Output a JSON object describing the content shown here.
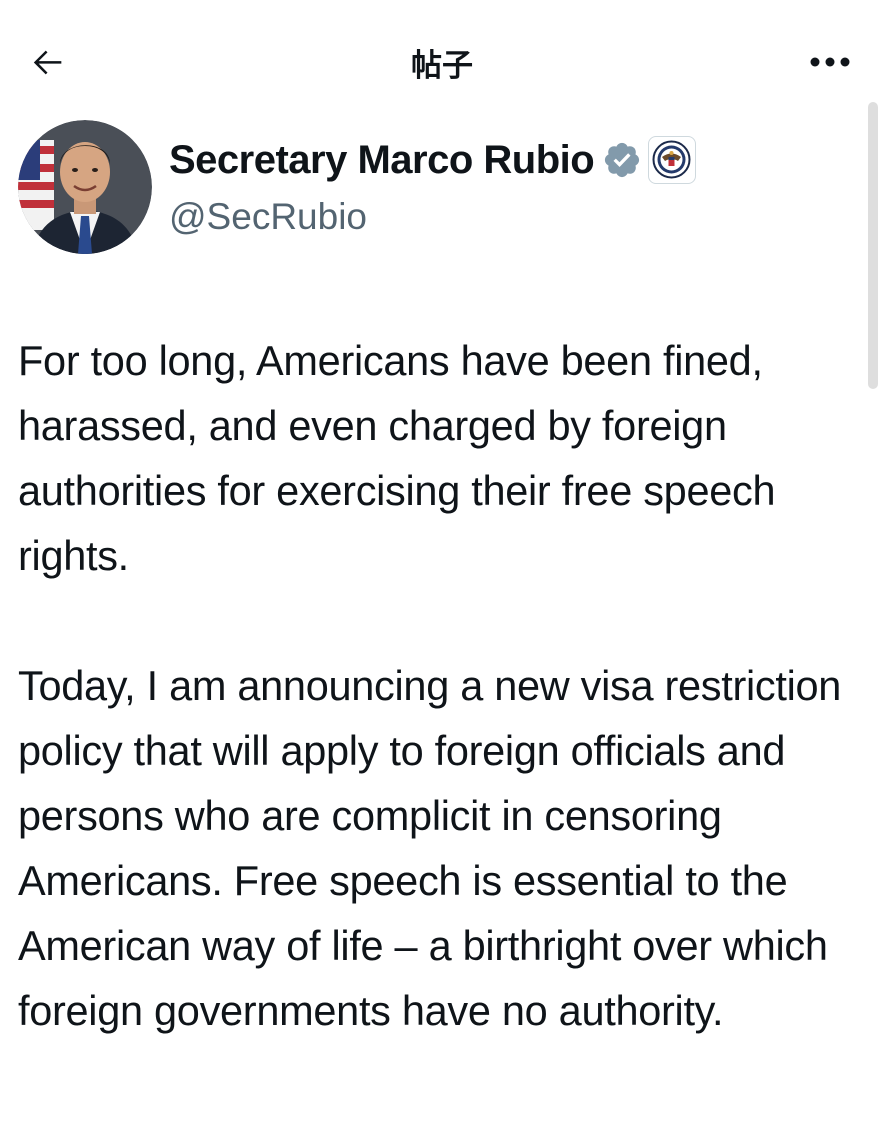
{
  "header": {
    "title": "帖子",
    "back_icon": "arrow-left-icon",
    "more_icon": "more-horizontal-icon"
  },
  "author": {
    "display_name": "Secretary Marco Rubio",
    "handle": "@SecRubio",
    "verified_badge": "verified-check-icon",
    "verified_color": "#829aab",
    "affiliation_badge": "state-department-seal-icon"
  },
  "tweet": {
    "paragraphs": [
      "For too long, Americans have been fined, harassed, and even charged by foreign authorities for exercising their free speech rights.",
      "Today, I am announcing a new visa restriction policy that will apply to foreign officials and persons who are complicit in censoring Americans. Free speech is essential to the American way of life – a birthright over which foreign governments have no authority."
    ]
  },
  "colors": {
    "text": "#0f1419",
    "secondary_text": "#536471",
    "background": "#ffffff"
  }
}
